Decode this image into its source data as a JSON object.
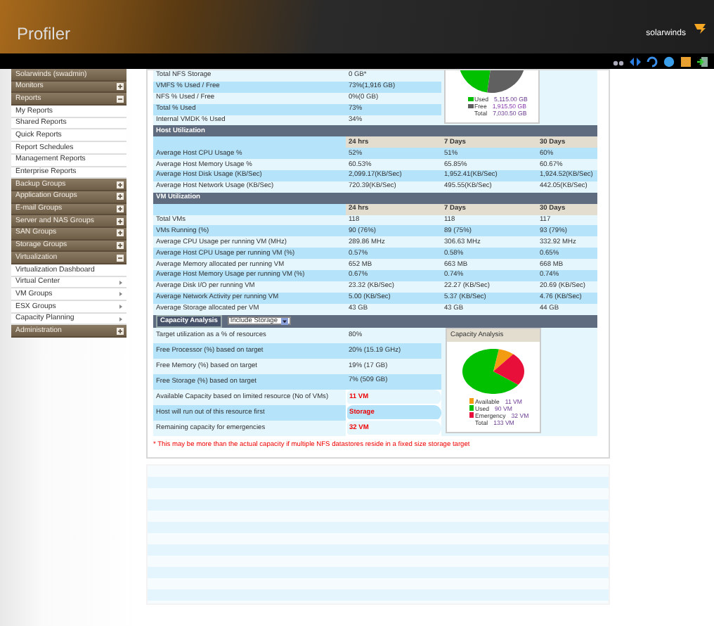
{
  "header": {
    "title": "Profiler",
    "brand": "solarwinds"
  },
  "sidebar": {
    "items": [
      {
        "label": "Solarwinds (swadmin)",
        "kind": "user"
      },
      {
        "label": "Monitors",
        "kind": "group",
        "expanded": false
      },
      {
        "label": "Reports",
        "kind": "group",
        "expanded": true
      },
      {
        "label": "My Reports",
        "kind": "link"
      },
      {
        "label": "Shared Reports",
        "kind": "link"
      },
      {
        "label": "Quick Reports",
        "kind": "link"
      },
      {
        "label": "Report Schedules",
        "kind": "link"
      },
      {
        "label": "Management Reports",
        "kind": "link"
      },
      {
        "label": "Enterprise Reports",
        "kind": "link"
      },
      {
        "label": "Backup Groups",
        "kind": "group",
        "expanded": false
      },
      {
        "label": "Application Groups",
        "kind": "group",
        "expanded": false
      },
      {
        "label": "E-mail Groups",
        "kind": "group",
        "expanded": false
      },
      {
        "label": "Server and NAS Groups",
        "kind": "group",
        "expanded": false
      },
      {
        "label": "SAN Groups",
        "kind": "group",
        "expanded": false
      },
      {
        "label": "Storage Groups",
        "kind": "group",
        "expanded": false
      },
      {
        "label": "Virtualization",
        "kind": "group",
        "expanded": true
      },
      {
        "label": "Virtualization Dashboard",
        "kind": "link"
      },
      {
        "label": "Virtual Center",
        "kind": "submenu"
      },
      {
        "label": "VM Groups",
        "kind": "submenu"
      },
      {
        "label": "ESX Groups",
        "kind": "submenu"
      },
      {
        "label": "Capacity Planning",
        "kind": "submenu"
      },
      {
        "label": "Administration",
        "kind": "group",
        "expanded": false
      }
    ]
  },
  "storage": {
    "rows": [
      {
        "label": "Total NFS Storage",
        "value": "0 GB*"
      },
      {
        "label": "VMFS % Used / Free",
        "value": "73%(1,916 GB)"
      },
      {
        "label": "NFS % Used / Free",
        "value": "0%(0 GB)"
      },
      {
        "label": "Total % Used",
        "value": "73%"
      },
      {
        "label": "Internal VMDK % Used",
        "value": "34%"
      }
    ],
    "legend": [
      {
        "label": "Used",
        "value": "5,115.00 GB",
        "color": "#00c000"
      },
      {
        "label": "Free",
        "value": "1,915.50 GB",
        "color": "#606060"
      },
      {
        "label": "Total",
        "value": "7,030.50 GB"
      }
    ]
  },
  "host_utilization": {
    "title": "Host Utilization",
    "columns": [
      "24 hrs",
      "7 Days",
      "30 Days"
    ],
    "rows": [
      {
        "label": "Average Host CPU Usage %",
        "values": [
          "52%",
          "51%",
          "60%"
        ]
      },
      {
        "label": "Average Host Memory Usage %",
        "values": [
          "60.53%",
          "65.85%",
          "60.67%"
        ]
      },
      {
        "label": "Average Host Disk Usage (KB/Sec)",
        "values": [
          "2,099.17(KB/Sec)",
          "1,952.41(KB/Sec)",
          "1,924.52(KB/Sec)"
        ]
      },
      {
        "label": "Average Host Network Usage (KB/Sec)",
        "values": [
          "720.39(KB/Sec)",
          "495.55(KB/Sec)",
          "442.05(KB/Sec)"
        ]
      }
    ]
  },
  "vm_utilization": {
    "title": "VM Utilization",
    "columns": [
      "24 hrs",
      "7 Days",
      "30 Days"
    ],
    "rows": [
      {
        "label": "Total VMs",
        "values": [
          "118",
          "118",
          "117"
        ]
      },
      {
        "label": "VMs Running (%)",
        "values": [
          "90 (76%)",
          "89 (75%)",
          "93 (79%)"
        ]
      },
      {
        "label": "Average CPU Usage per running VM (MHz)",
        "values": [
          "289.86 MHz",
          "306.63 MHz",
          "332.92 MHz"
        ]
      },
      {
        "label": "Average Host CPU Usage per running VM (%)",
        "values": [
          "0.57%",
          "0.58%",
          "0.65%"
        ]
      },
      {
        "label": "Average Memory allocated per running VM",
        "values": [
          "652 MB",
          "663 MB",
          "668 MB"
        ]
      },
      {
        "label": "Average Host Memory Usage per running VM (%)",
        "values": [
          "0.67%",
          "0.74%",
          "0.74%"
        ]
      },
      {
        "label": "Average Disk I/O per running VM",
        "values": [
          "23.32 (KB/Sec)",
          "22.27 (KB/Sec)",
          "20.69 (KB/Sec)"
        ]
      },
      {
        "label": "Average Network Activity per running VM",
        "values": [
          "5.00 (KB/Sec)",
          "5.37 (KB/Sec)",
          "4.76 (KB/Sec)"
        ]
      },
      {
        "label": "Average Storage allocated per VM",
        "values": [
          "43 GB",
          "43 GB",
          "44 GB"
        ]
      }
    ]
  },
  "capacity_analysis": {
    "title": "Capacity Analysis",
    "select": {
      "value": "Include Storage"
    },
    "rows": [
      {
        "label": "Target utilization as a % of resources",
        "value": "80%",
        "alert": false
      },
      {
        "label": "Free Processor (%) based on target",
        "value": "20% (15.19 GHz)",
        "alert": false
      },
      {
        "label": "Free Memory (%) based on target",
        "value": "19% (17 GB)",
        "alert": false
      },
      {
        "label": "Free Storage (%) based on target",
        "value": "7% (509 GB)",
        "alert": false
      },
      {
        "label": "Available Capacity based on limited resource (No of VMs)",
        "value": "11 VM",
        "alert": true
      },
      {
        "label": "Host will run out of this resource first",
        "value": "Storage",
        "alert": true
      },
      {
        "label": "Remaining capacity for emergencies",
        "value": "32 VM",
        "alert": true
      }
    ],
    "panel": {
      "title": "Capacity Analysis",
      "legend": [
        {
          "label": "Available",
          "value": "11 VM",
          "color": "#f39c12"
        },
        {
          "label": "Used",
          "value": "90 VM",
          "color": "#00c000"
        },
        {
          "label": "Emergency",
          "value": "32 VM",
          "color": "#e8103a"
        },
        {
          "label": "Total",
          "value": "133 VM"
        }
      ]
    }
  },
  "footnote": "* This may be more than the actual capacity if multiple NFS datastores reside in a fixed size storage target"
}
